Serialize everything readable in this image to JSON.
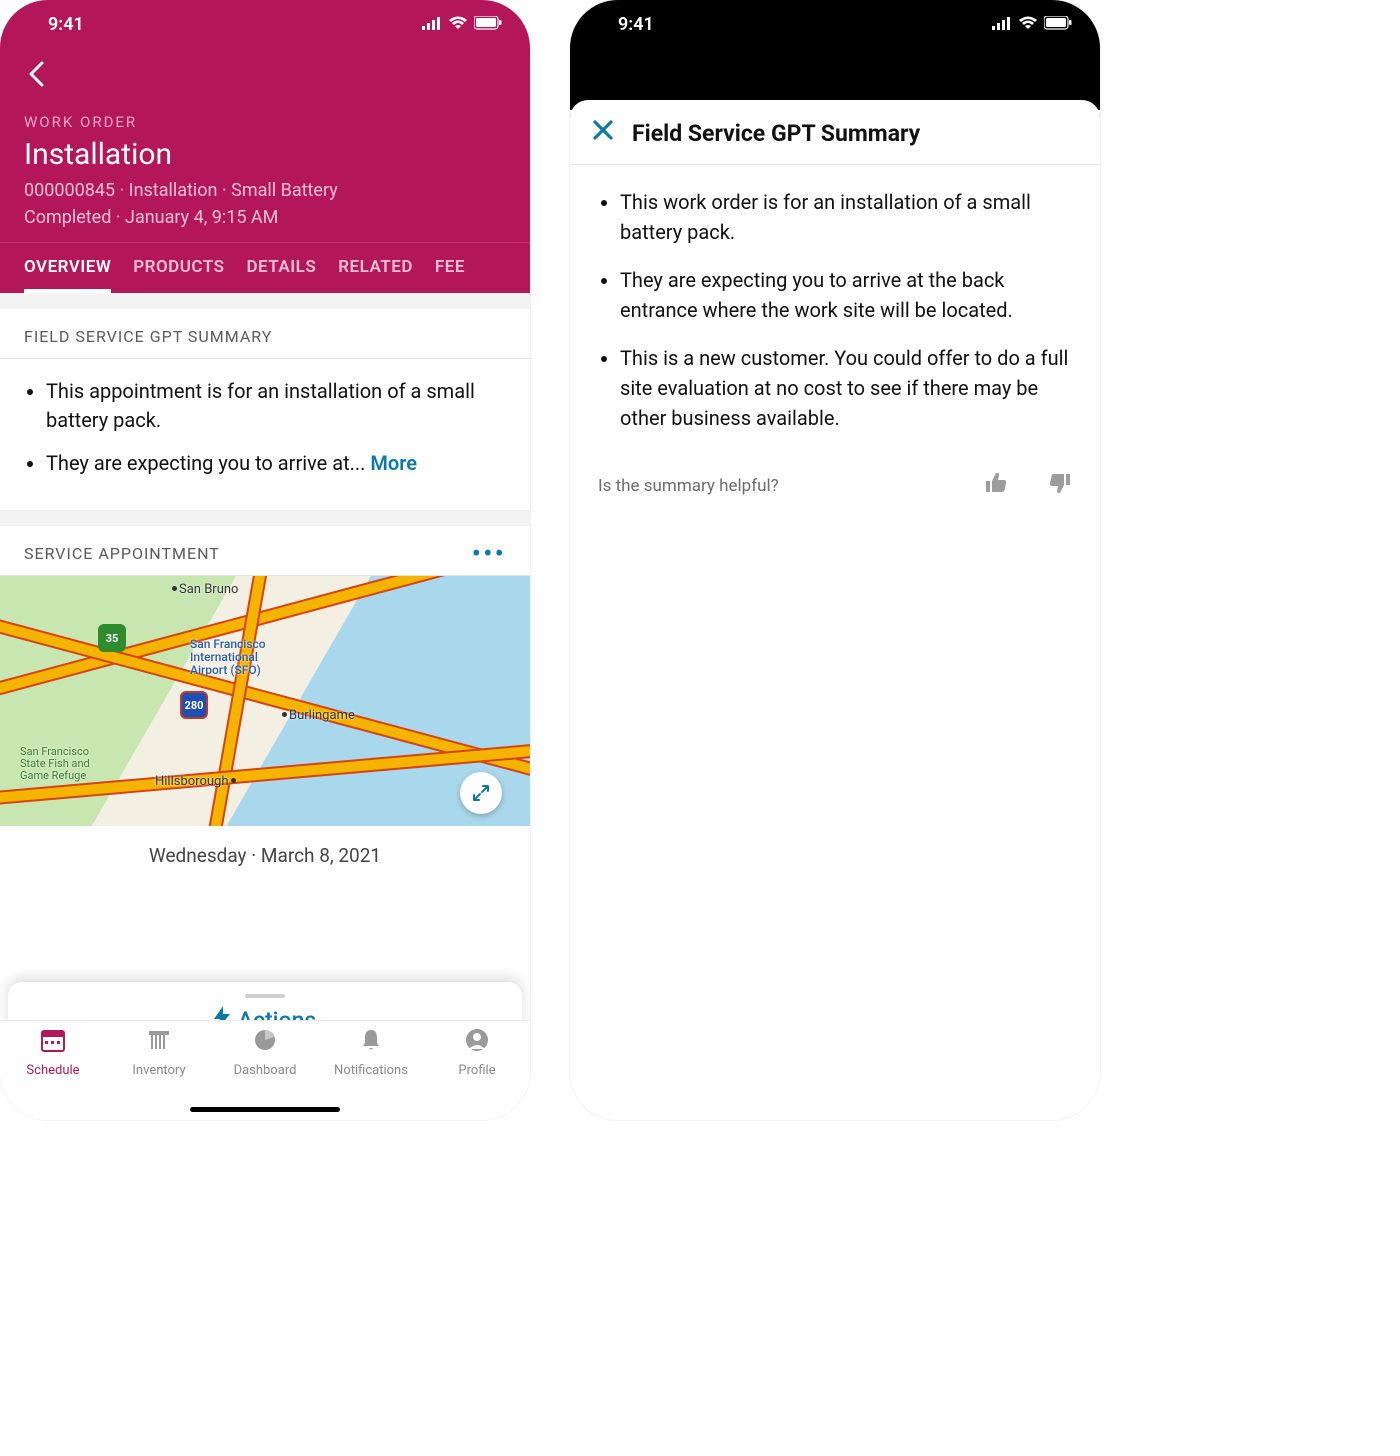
{
  "status_time": "9:41",
  "left": {
    "header": {
      "label": "WORK ORDER",
      "title": "Installation",
      "sub": "000000845 · Installation · Small Battery",
      "status": "Completed · January 4, 9:15 AM"
    },
    "tabs": [
      "OVERVIEW",
      "PRODUCTS",
      "DETAILS",
      "RELATED",
      "FEE"
    ],
    "summary": {
      "heading": "FIELD SERVICE GPT SUMMARY",
      "bullets": {
        "b1": "This appointment is for an installation of a small battery pack.",
        "b2": "They are expecting you to arrive at... "
      },
      "more": "More"
    },
    "appointment": {
      "heading": "SERVICE APPOINTMENT",
      "map_labels": {
        "san_bruno": "San Bruno",
        "sfo": "San Francisco\nInternational\nAirport (SFO)",
        "burlingame": "Burlingame",
        "hillsborough": "Hillsborough",
        "refuge": "San Francisco\nState Fish and\nGame Refuge",
        "shield35": "35",
        "shield280": "280"
      },
      "date": "Wednesday · March 8, 2021"
    },
    "actions_label": "Actions",
    "tabbar": {
      "schedule": "Schedule",
      "inventory": "Inventory",
      "dashboard": "Dashboard",
      "notifications": "Notifications",
      "profile": "Profile"
    }
  },
  "right": {
    "modal_title": "Field Service GPT Summary",
    "bullets": {
      "b1": "This work order is for an installation of a small battery pack.",
      "b2": "They are expecting you to arrive at the back entrance where the work site will be located.",
      "b3": "This is a new customer. You could offer to do a full site evaluation at no cost to see if there may be other business available."
    },
    "feedback_prompt": "Is the summary helpful?"
  }
}
